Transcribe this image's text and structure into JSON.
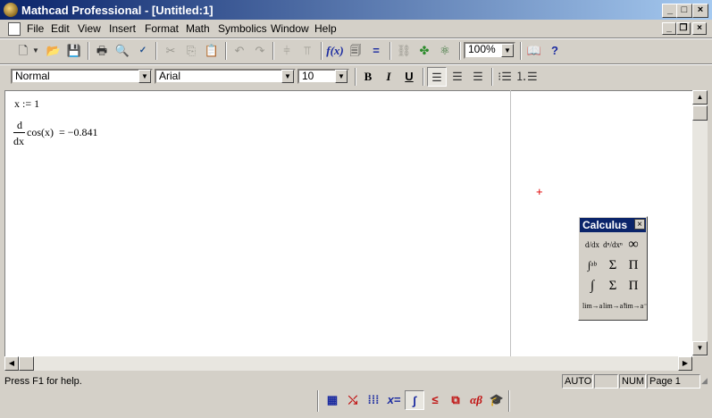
{
  "window": {
    "title": "Mathcad Professional - [Untitled:1]"
  },
  "menu": [
    "File",
    "Edit",
    "View",
    "Insert",
    "Format",
    "Math",
    "Symbolics",
    "Window",
    "Help"
  ],
  "toolbar": {
    "zoom": "100%",
    "fx_label": "f(x)",
    "eq_label": "="
  },
  "format_bar": {
    "style": "Normal",
    "font": "Arial",
    "size": "10",
    "bold": "B",
    "italic": "I",
    "underline": "U"
  },
  "worksheet": {
    "def_line": "x := 1",
    "deriv_numerator": "d",
    "deriv_denominator": "dx",
    "deriv_expr": "cos(x)",
    "deriv_result": "=  −0.841"
  },
  "calculus_palette": {
    "title": "Calculus",
    "buttons": [
      "d/dx",
      "dⁿ/dxⁿ",
      "∞",
      "∫ᵃᵇ",
      "Σ",
      "Π",
      "∫",
      "Σ",
      "Π",
      "lim→a",
      "lim→a⁺",
      "lim→a⁻"
    ]
  },
  "status": {
    "help": "Press F1 for help.",
    "mode": "AUTO",
    "num": "NUM",
    "page": "Page 1"
  },
  "bottom_toolbar": {
    "xeq_label": "x=",
    "alphabeta_label": "αβ"
  },
  "colors": {
    "title_bar": "#0a246a",
    "cursor": "#e00000"
  }
}
